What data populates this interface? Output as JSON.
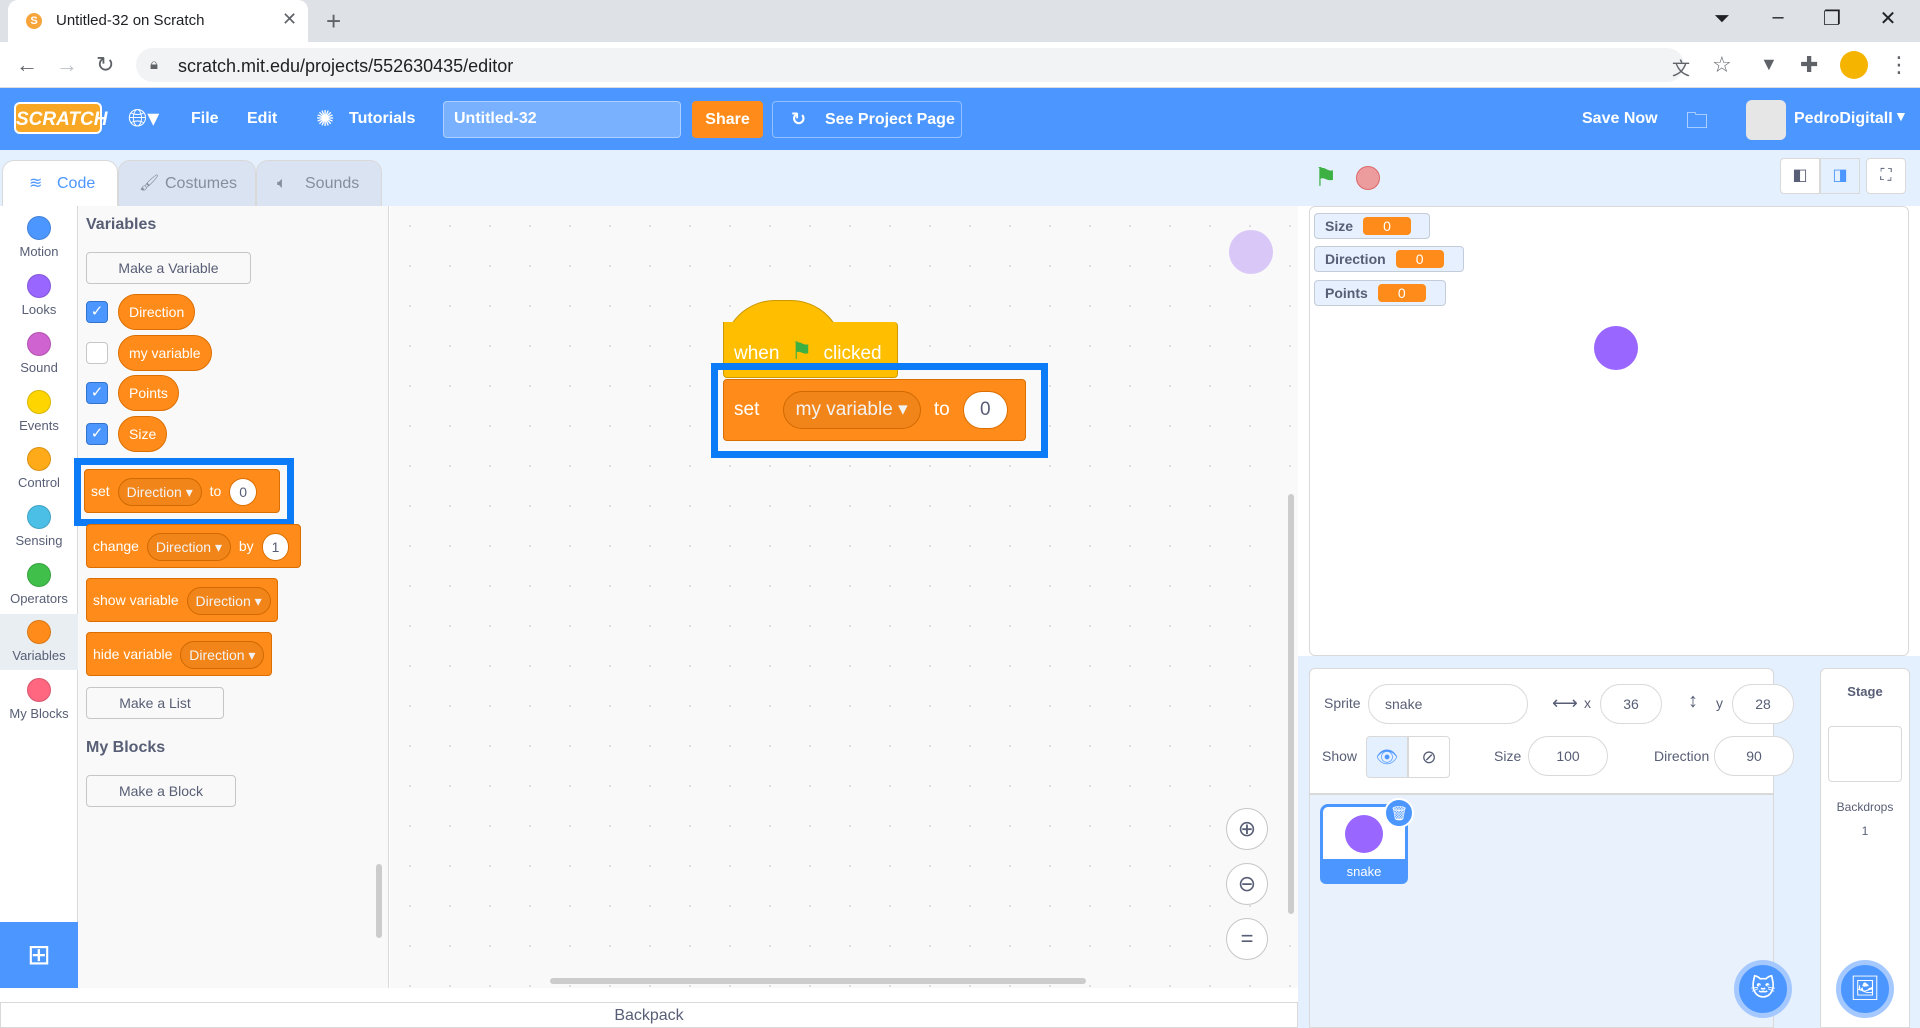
{
  "browser": {
    "tab_title": "Untitled-32 on Scratch",
    "url": "scratch.mit.edu/projects/552630435/editor"
  },
  "menu": {
    "logo": "SCRATCH",
    "file": "File",
    "edit": "Edit",
    "tutorials": "Tutorials",
    "project_title": "Untitled-32",
    "share": "Share",
    "see_project_page": "See Project Page",
    "save_now": "Save Now",
    "username": "PedroDigitalI"
  },
  "editor_tabs": [
    "Code",
    "Costumes",
    "Sounds"
  ],
  "categories": [
    {
      "label": "Motion",
      "color": "#4c97ff"
    },
    {
      "label": "Looks",
      "color": "#9966ff"
    },
    {
      "label": "Sound",
      "color": "#cf63cf"
    },
    {
      "label": "Events",
      "color": "#ffd500"
    },
    {
      "label": "Control",
      "color": "#ffab19"
    },
    {
      "label": "Sensing",
      "color": "#4cbfe6"
    },
    {
      "label": "Operators",
      "color": "#40bf4a"
    },
    {
      "label": "Variables",
      "color": "#ff8c1a"
    },
    {
      "label": "My Blocks",
      "color": "#ff6680"
    }
  ],
  "palette": {
    "heading": "Variables",
    "make_variable": "Make a Variable",
    "variables": [
      {
        "name": "Direction",
        "checked": true
      },
      {
        "name": "my variable",
        "checked": false
      },
      {
        "name": "Points",
        "checked": true
      },
      {
        "name": "Size",
        "checked": true
      }
    ],
    "set_block": {
      "word": "set",
      "var": "Direction",
      "to": "to",
      "value": "0"
    },
    "change_block": {
      "word": "change",
      "var": "Direction",
      "by": "by",
      "value": "1"
    },
    "show_block": {
      "word": "show variable",
      "var": "Direction"
    },
    "hide_block": {
      "word": "hide variable",
      "var": "Direction"
    },
    "make_list": "Make a List",
    "myblocks_heading": "My Blocks",
    "make_block": "Make a Block"
  },
  "script": {
    "hat_when": "when",
    "hat_clicked": "clicked",
    "set_word": "set",
    "set_var": "my variable",
    "set_to": "to",
    "set_value": "0"
  },
  "backpack": "Backpack",
  "monitors": [
    {
      "name": "Size",
      "value": "0"
    },
    {
      "name": "Direction",
      "value": "0"
    },
    {
      "name": "Points",
      "value": "0"
    }
  ],
  "sprite_info": {
    "sprite_label": "Sprite",
    "sprite_name": "snake",
    "x_label": "x",
    "x": "36",
    "y_label": "y",
    "y": "28",
    "show_label": "Show",
    "size_label": "Size",
    "size": "100",
    "direction_label": "Direction",
    "direction": "90"
  },
  "sprite_tile": "snake",
  "stage_pane": {
    "title": "Stage",
    "backdrops_label": "Backdrops",
    "backdrops_count": "1"
  },
  "colors": {
    "menu_blue": "#4c97ff",
    "variables_orange": "#ff8c1a",
    "events_yellow": "#ffbf00",
    "highlight": "#0b7bf7",
    "sprite_purple": "#9966ff"
  }
}
